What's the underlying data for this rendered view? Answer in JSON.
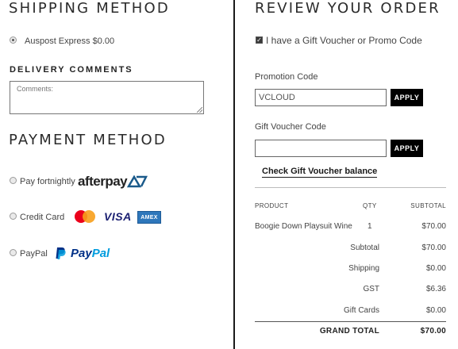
{
  "shipping": {
    "title": "SHIPPING METHOD",
    "option_label": "Auspost Express $0.00"
  },
  "delivery": {
    "title": "DELIVERY COMMENTS",
    "placeholder": "Comments:"
  },
  "payment": {
    "title": "PAYMENT METHOD",
    "options": [
      {
        "label": "Pay fortnightly",
        "brand": "afterpay"
      },
      {
        "label": "Credit Card",
        "brands": [
          "mastercard",
          "VISA",
          "AMEX"
        ]
      },
      {
        "label": "PayPal",
        "brand_a": "Pay",
        "brand_b": "Pal"
      }
    ]
  },
  "review": {
    "title": "REVIEW YOUR ORDER",
    "voucher_checkbox_label": "I have a Gift Voucher or Promo Code",
    "voucher_checked": true,
    "promo_label": "Promotion Code",
    "promo_value": "VCLOUD",
    "apply_label": "APPLY",
    "gift_label": "Gift Voucher Code",
    "gift_value": "",
    "check_balance_label": "Check Gift Voucher balance"
  },
  "table": {
    "headers": {
      "product": "PRODUCT",
      "qty": "QTY",
      "subtotal": "SUBTOTAL"
    },
    "items": [
      {
        "product": "Boogie Down Playsuit Wine",
        "qty": "1",
        "subtotal": "$70.00"
      }
    ],
    "summary": [
      {
        "label": "Subtotal",
        "value": "$70.00"
      },
      {
        "label": "Shipping",
        "value": "$0.00"
      },
      {
        "label": "GST",
        "value": "$6.36"
      },
      {
        "label": "Gift Cards",
        "value": "$0.00"
      }
    ],
    "grand_total": {
      "label": "GRAND TOTAL",
      "value": "$70.00"
    }
  },
  "colors": {
    "accent": "#000000",
    "afterpay": "#1a5a8a",
    "paypal_dark": "#003087",
    "paypal_light": "#009cde"
  }
}
